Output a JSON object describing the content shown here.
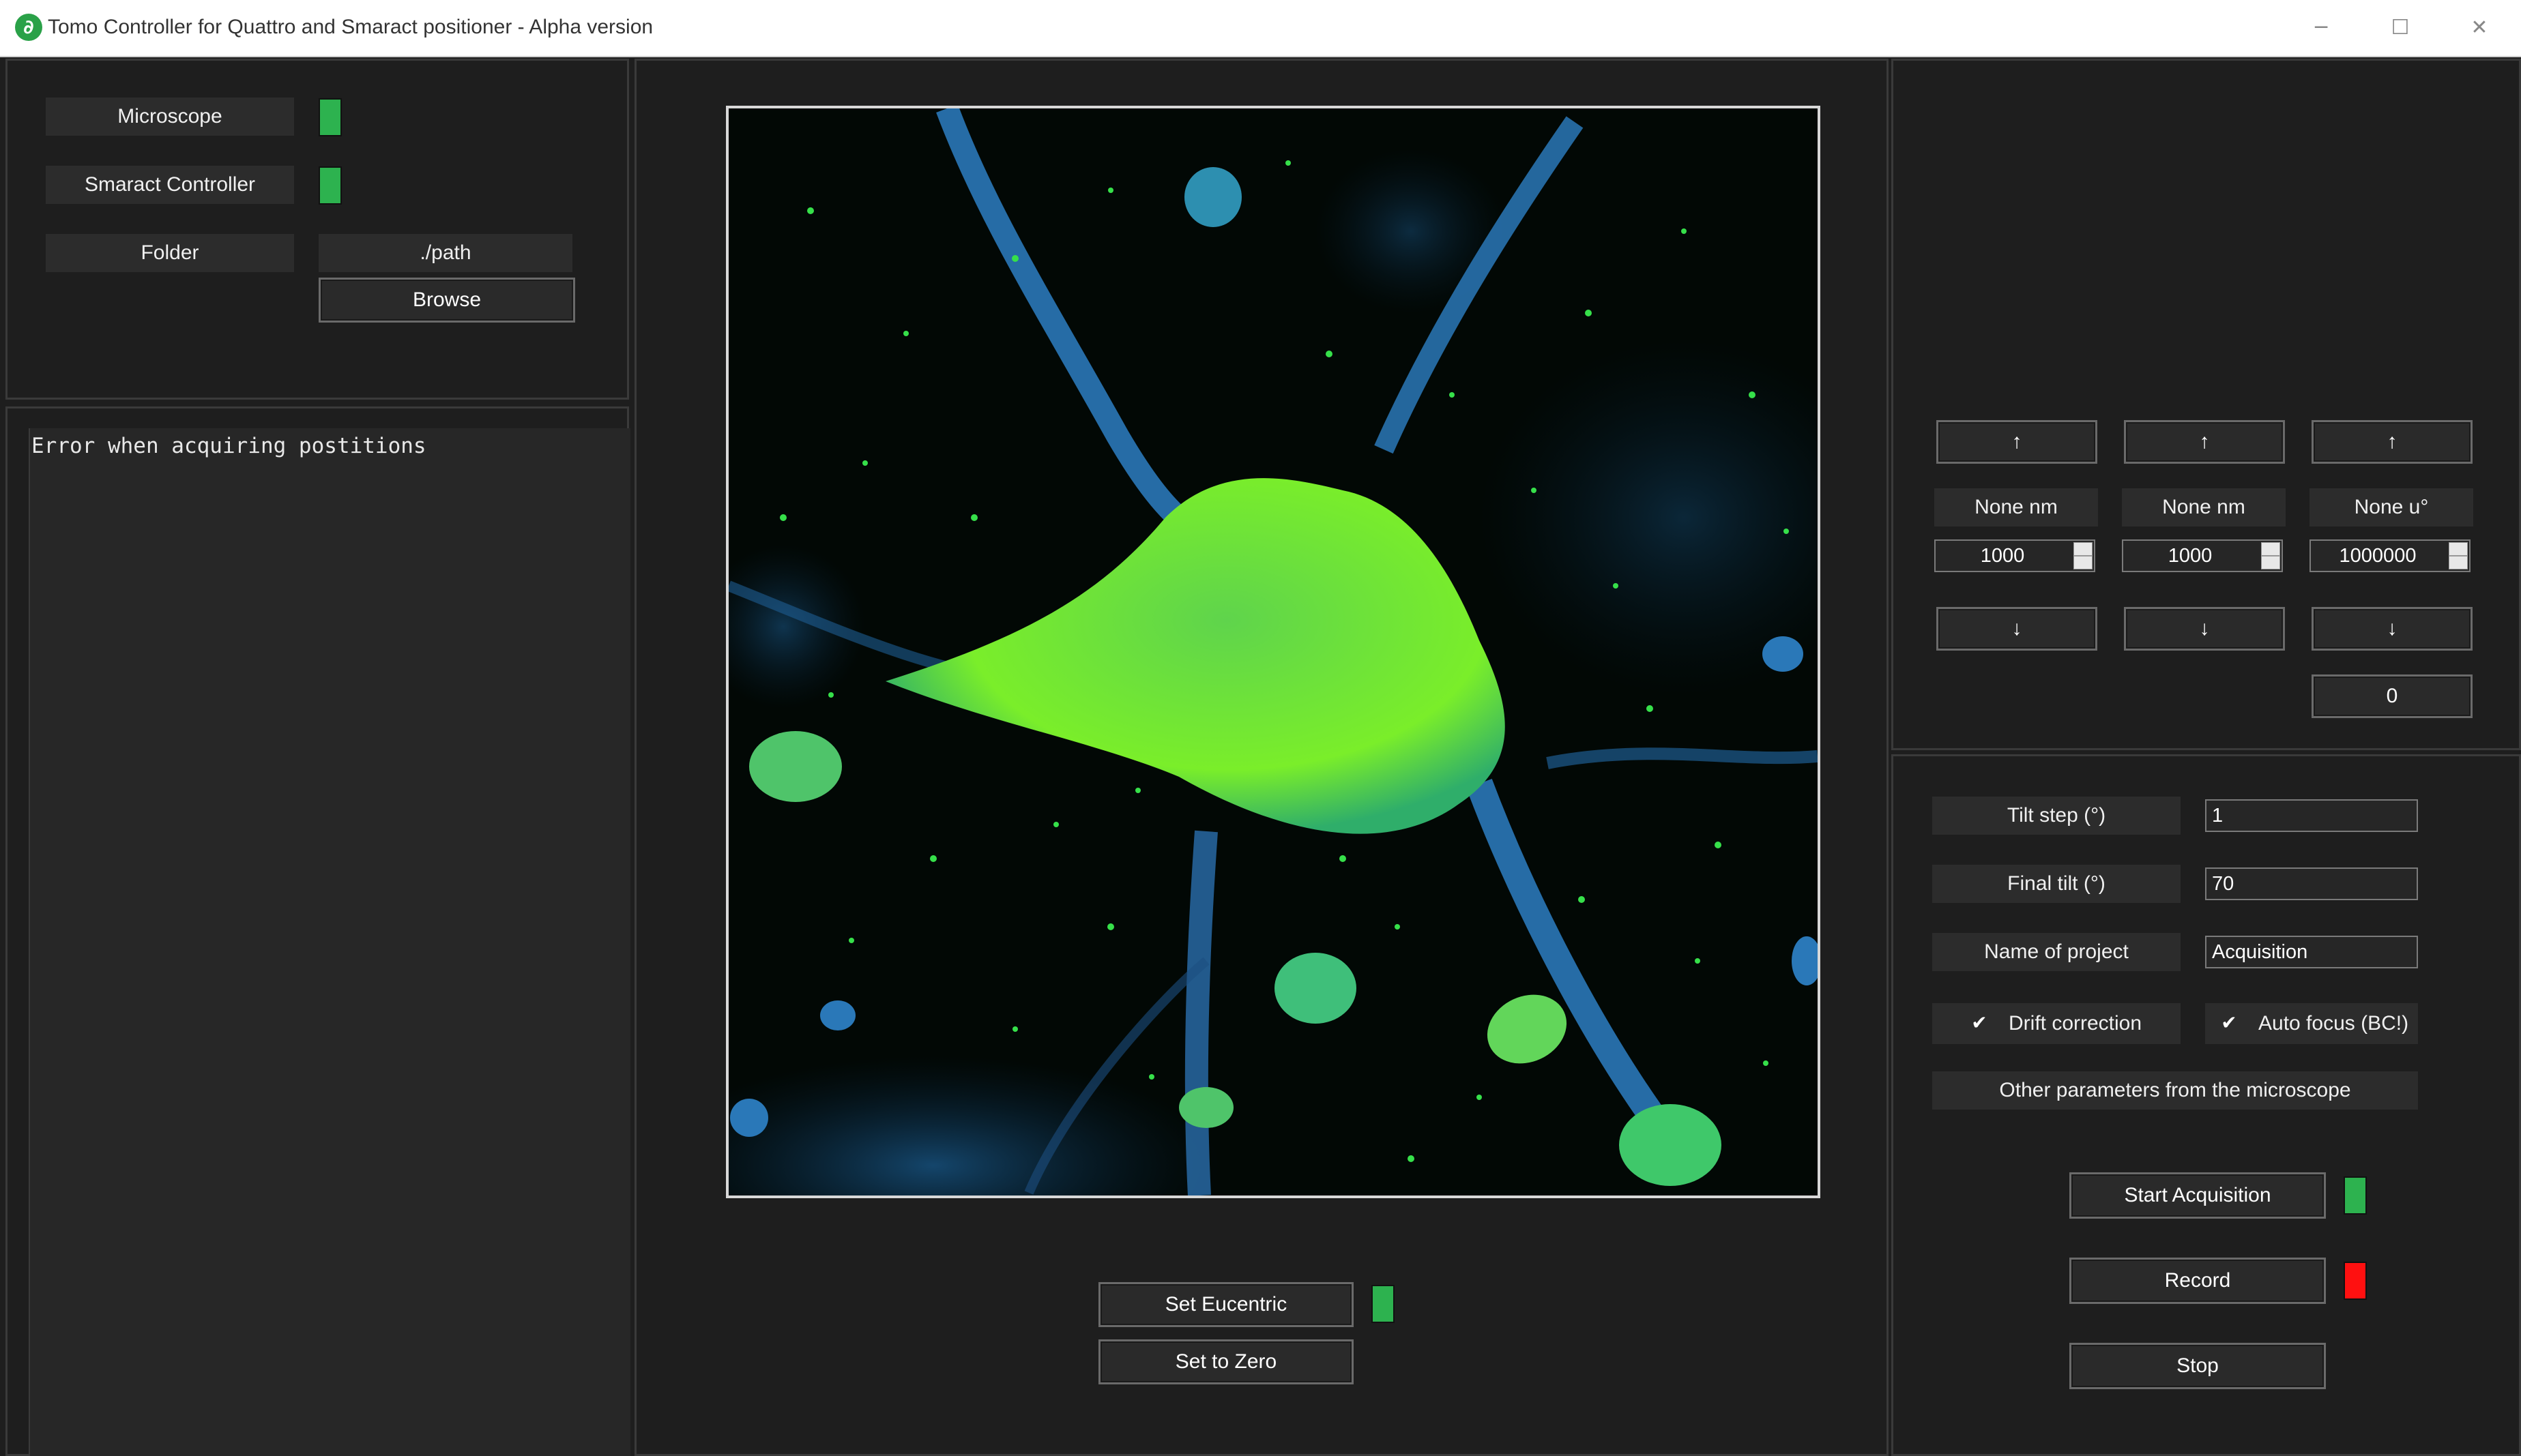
{
  "window": {
    "title": "Tomo Controller for Quattro and Smaract positioner - Alpha version",
    "minimize_icon": "minimize-icon",
    "maximize_icon": "maximize-icon",
    "close_icon": "close-icon"
  },
  "connections": {
    "microscope_label": "Microscope",
    "microscope_status": "connected",
    "smaract_label": "Smaract Controller",
    "smaract_status": "connected",
    "folder_label": "Folder",
    "folder_path": "./path",
    "browse_label": "Browse"
  },
  "console": {
    "message": "Error when acquiring postitions"
  },
  "center": {
    "set_eucentric_label": "Set Eucentric",
    "eucentric_status": "ok",
    "set_zero_label": "Set to Zero"
  },
  "positioner": {
    "up_arrow": "↑",
    "down_arrow": "↓",
    "axes": [
      {
        "readout": "None nm",
        "step": "1000"
      },
      {
        "readout": "None nm",
        "step": "1000"
      },
      {
        "readout": "None u°",
        "step": "1000000"
      }
    ],
    "extra_value": "0"
  },
  "acquisition": {
    "tilt_step_label": "Tilt step (°)",
    "tilt_step_value": "1",
    "final_tilt_label": "Final tilt (°)",
    "final_tilt_value": "70",
    "project_label": "Name of project",
    "project_value": "Acquisition",
    "drift_correction_label": "Drift correction",
    "drift_correction_checked": true,
    "autofocus_label": "Auto focus (BC!)",
    "autofocus_checked": true,
    "other_params_label": "Other parameters from the microscope",
    "start_label": "Start Acquisition",
    "start_status": "ready",
    "record_label": "Record",
    "record_status": "inactive",
    "stop_label": "Stop"
  },
  "colors": {
    "status_green": "#2db24f",
    "status_red": "#ff1010",
    "background": "#1e1e1e"
  }
}
